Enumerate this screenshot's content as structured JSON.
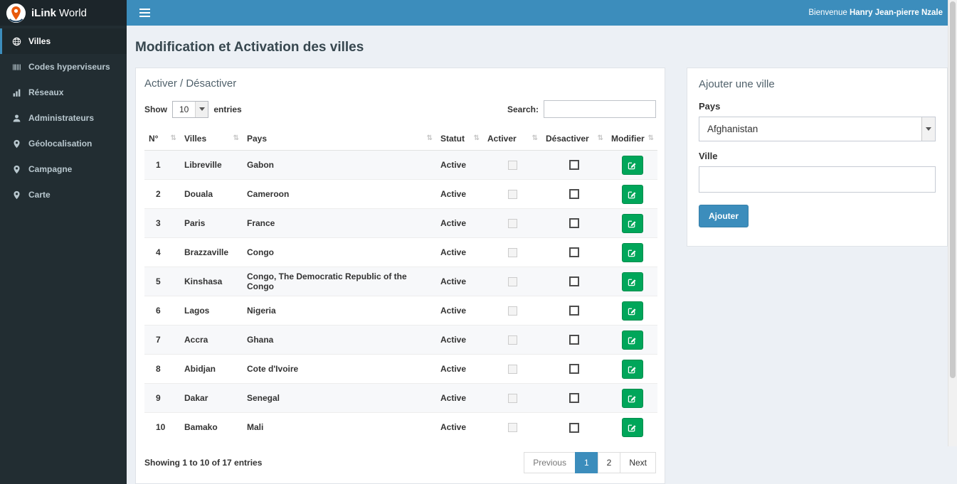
{
  "brand": {
    "bold": "iLink",
    "light": "World"
  },
  "topbar": {
    "welcome_prefix": "Bienvenue",
    "user_name": "Hanry Jean-pierre Nzale"
  },
  "sidebar": {
    "items": [
      {
        "label": "Villes",
        "icon": "globe-icon",
        "active": true
      },
      {
        "label": "Codes hyperviseurs",
        "icon": "barcode-icon"
      },
      {
        "label": "Réseaux",
        "icon": "chart-bars-icon"
      },
      {
        "label": "Administrateurs",
        "icon": "user-icon"
      },
      {
        "label": "Géolocalisation",
        "icon": "map-pin-icon"
      },
      {
        "label": "Campagne",
        "icon": "map-pin-icon"
      },
      {
        "label": "Carte",
        "icon": "map-pin-icon"
      }
    ]
  },
  "page": {
    "title": "Modification et Activation des villes"
  },
  "table_panel": {
    "title": "Activer / Désactiver",
    "length": {
      "show": "Show",
      "value": "10",
      "entries": "entries"
    },
    "search_label": "Search:",
    "columns": [
      {
        "label": "N°"
      },
      {
        "label": "Villes"
      },
      {
        "label": "Pays"
      },
      {
        "label": "Statut"
      },
      {
        "label": "Activer"
      },
      {
        "label": "Désactiver"
      },
      {
        "label": "Modifier"
      }
    ],
    "rows": [
      {
        "n": "1",
        "ville": "Libreville",
        "pays": "Gabon",
        "statut": "Active"
      },
      {
        "n": "2",
        "ville": "Douala",
        "pays": "Cameroon",
        "statut": "Active"
      },
      {
        "n": "3",
        "ville": "Paris",
        "pays": "France",
        "statut": "Active"
      },
      {
        "n": "4",
        "ville": "Brazzaville",
        "pays": "Congo",
        "statut": "Active"
      },
      {
        "n": "5",
        "ville": "Kinshasa",
        "pays": "Congo, The Democratic Republic of the Congo",
        "statut": "Active"
      },
      {
        "n": "6",
        "ville": "Lagos",
        "pays": "Nigeria",
        "statut": "Active"
      },
      {
        "n": "7",
        "ville": "Accra",
        "pays": "Ghana",
        "statut": "Active"
      },
      {
        "n": "8",
        "ville": "Abidjan",
        "pays": "Cote d'Ivoire",
        "statut": "Active"
      },
      {
        "n": "9",
        "ville": "Dakar",
        "pays": "Senegal",
        "statut": "Active"
      },
      {
        "n": "10",
        "ville": "Bamako",
        "pays": "Mali",
        "statut": "Active"
      }
    ],
    "info": "Showing 1 to 10 of 17 entries",
    "pagination": [
      {
        "label": "Previous",
        "state": "disabled"
      },
      {
        "label": "1",
        "state": "active"
      },
      {
        "label": "2"
      },
      {
        "label": "Next"
      }
    ]
  },
  "add_panel": {
    "title": "Ajouter une ville",
    "country_label": "Pays",
    "country_value": "Afghanistan",
    "city_label": "Ville",
    "city_value": "",
    "submit_label": "Ajouter"
  }
}
